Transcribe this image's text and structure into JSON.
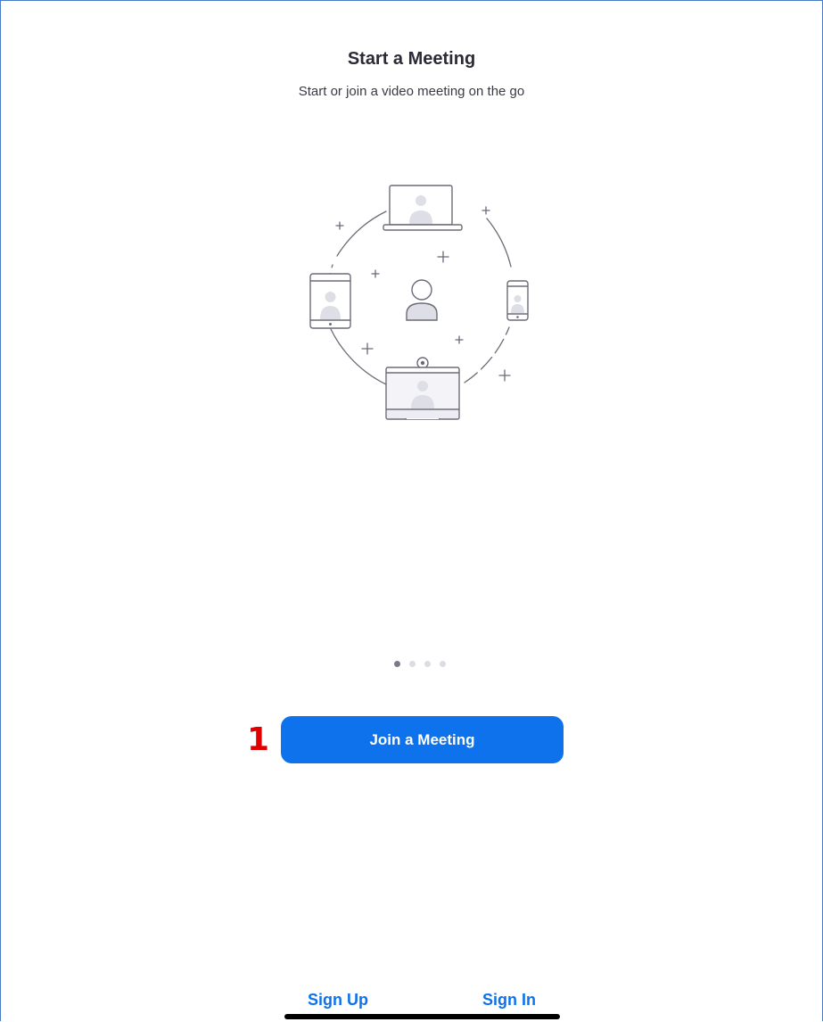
{
  "header": {
    "title": "Start a Meeting",
    "subtitle": "Start or join a video meeting on the go"
  },
  "illustration": {
    "icon": "video-meeting-devices-illustration",
    "stroke_color": "#6b6b78",
    "fill_color": "#dedee6"
  },
  "pagination": {
    "total": 4,
    "active_index": 0
  },
  "annotation": {
    "step_number": "1",
    "color": "#e00000"
  },
  "actions": {
    "join_label": "Join a Meeting",
    "sign_up_label": "Sign Up",
    "sign_in_label": "Sign In",
    "accent_color": "#0e72ed"
  }
}
